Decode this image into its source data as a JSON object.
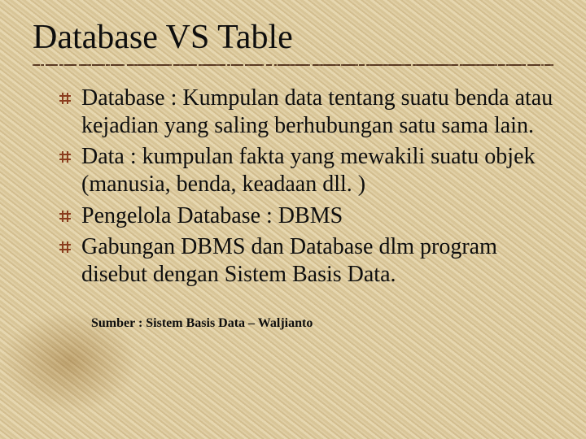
{
  "title": "Database VS Table",
  "bullets": [
    "Database : Kumpulan data tentang suatu benda atau kejadian yang saling berhubungan satu sama lain.",
    "Data : kumpulan fakta yang mewakili suatu objek (manusia, benda, keadaan dll. )",
    "Pengelola Database : DBMS",
    "Gabungan DBMS dan Database dlm program disebut dengan Sistem Basis Data."
  ],
  "source": "Sumber : Sistem Basis Data – Waljianto",
  "colors": {
    "bullet": "#8a3c1e",
    "text": "#0e0e0e"
  }
}
